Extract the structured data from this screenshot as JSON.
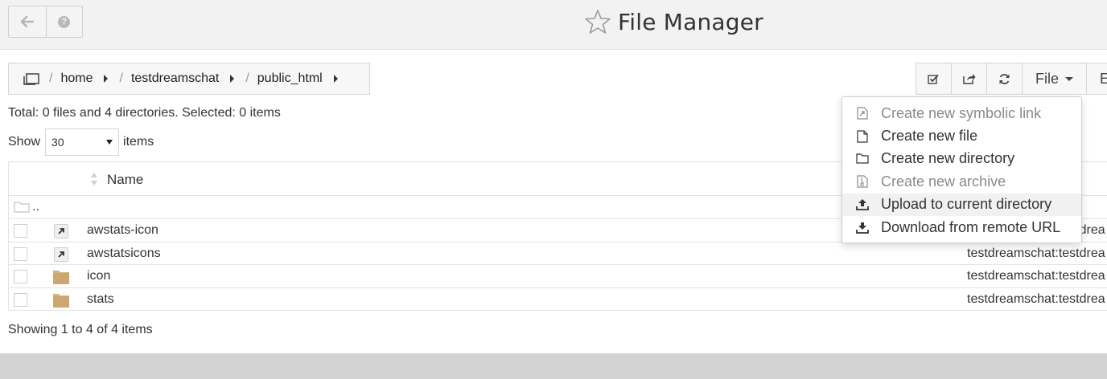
{
  "header": {
    "title": "File Manager",
    "back_icon": "arrow-left-icon",
    "help_glyph": "?"
  },
  "breadcrumb": {
    "items": [
      "home",
      "testdreamschat",
      "public_html"
    ],
    "separator": "/"
  },
  "toolbar": {
    "file_label": "File",
    "edit_label": "Ed"
  },
  "summary": "Total: 0 files and 4 directories. Selected: 0 items",
  "pager": {
    "show_label": "Show",
    "page_size": "30",
    "items_label": "items",
    "footer": "Showing 1 to 4 of 4 items"
  },
  "table": {
    "name_header": "Name",
    "up_label": "..",
    "rows": [
      {
        "name": "awstats-icon",
        "type": "symlink",
        "owner": "testdreamschat:testdrea"
      },
      {
        "name": "awstatsicons",
        "type": "symlink",
        "owner": "testdreamschat:testdrea"
      },
      {
        "name": "icon",
        "type": "folder",
        "owner": "testdreamschat:testdrea"
      },
      {
        "name": "stats",
        "type": "folder",
        "owner": "testdreamschat:testdrea"
      }
    ]
  },
  "menu": {
    "items": [
      {
        "label": "Create new symbolic link",
        "icon": "symlink-icon",
        "disabled": true
      },
      {
        "label": "Create new file",
        "icon": "file-icon",
        "disabled": false
      },
      {
        "label": "Create new directory",
        "icon": "folder-icon",
        "disabled": false
      },
      {
        "label": "Create new archive",
        "icon": "archive-icon",
        "disabled": true
      },
      {
        "label": "Upload to current directory",
        "icon": "upload-icon",
        "disabled": false
      },
      {
        "label": "Download from remote URL",
        "icon": "download-icon",
        "disabled": false
      }
    ]
  },
  "colors": {
    "header_bg": "#f2f2f2",
    "folder": "#d6b47e",
    "footer_bg": "#d3d3d3"
  }
}
